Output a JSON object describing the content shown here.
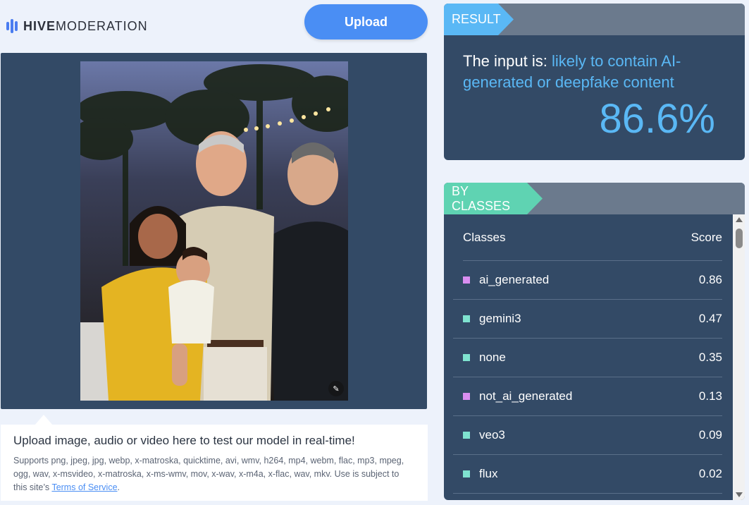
{
  "logo": {
    "bold": "HIVE",
    "light": "MODERATION",
    "icon": "hive-bars-icon"
  },
  "upload_button": {
    "label": "Upload"
  },
  "image_panel": {
    "corner_icon": "image-settings-icon"
  },
  "info": {
    "title": "Upload image, audio or video here to test our model in real-time!",
    "text": "Supports png, jpeg, jpg, webp, x-matroska, quicktime, avi, wmv, h264, mp4, webm, flac, mp3, mpeg, ogg, wav, x-msvideo, x-matroska, x-ms-wmv, mov, x-wav, x-m4a, x-flac, wav, mkv. Use is subject to this site’s ",
    "link": "Terms of Service",
    "suffix": "."
  },
  "result": {
    "tag": "RESULT",
    "prefix": "The input is: ",
    "verdict": "likely to contain AI-generated or deepfake content",
    "score": "86.6%"
  },
  "classes": {
    "tag": "BY CLASSES",
    "col_class": "Classes",
    "col_score": "Score",
    "rows": [
      {
        "name": "ai_generated",
        "score": "0.86",
        "color": "#d98ef0"
      },
      {
        "name": "gemini3",
        "score": "0.47",
        "color": "#7fe3d0"
      },
      {
        "name": "none",
        "score": "0.35",
        "color": "#7fe3d0"
      },
      {
        "name": "not_ai_generated",
        "score": "0.13",
        "color": "#d98ef0"
      },
      {
        "name": "veo3",
        "score": "0.09",
        "color": "#7fe3d0"
      },
      {
        "name": "flux",
        "score": "0.02",
        "color": "#7fe3d0"
      }
    ]
  },
  "colors": {
    "accent": "#5ab8f5",
    "panel": "#334a66",
    "button": "#4a8ef4",
    "classes_tag": "#5fd3b2"
  }
}
